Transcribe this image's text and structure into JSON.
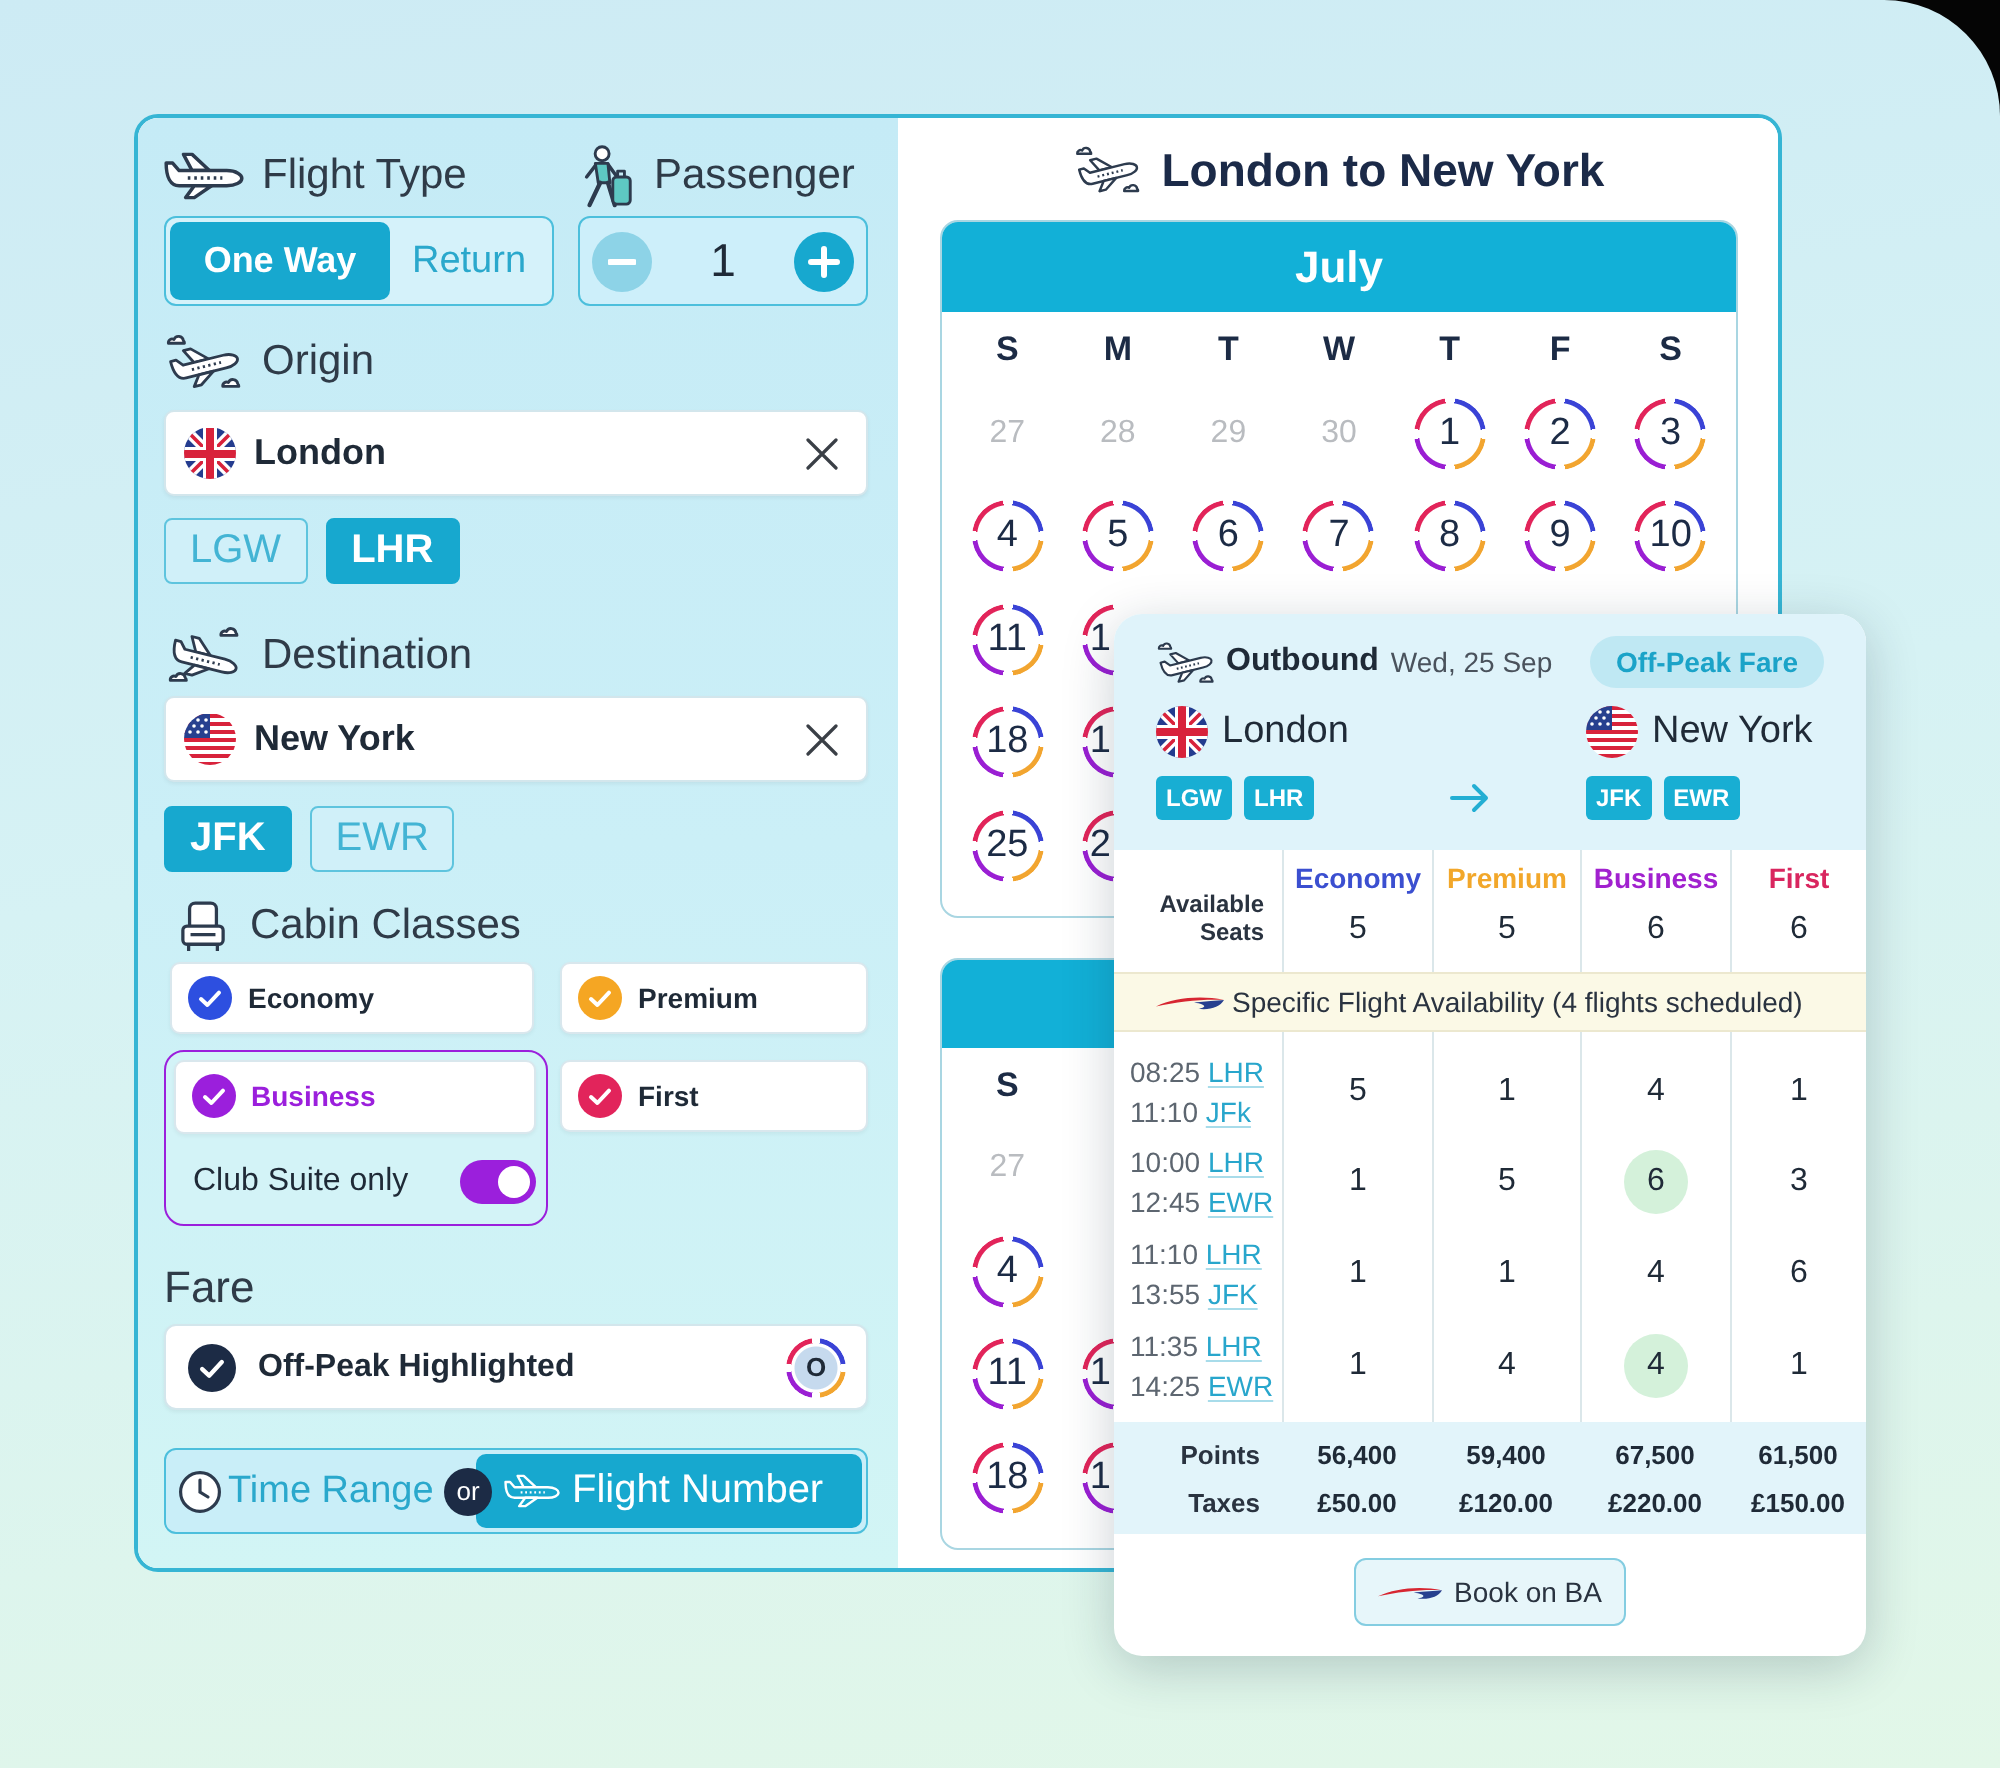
{
  "form": {
    "flight_type": {
      "label": "Flight Type",
      "options": [
        {
          "label": "One Way",
          "selected": true
        },
        {
          "label": "Return",
          "selected": false
        }
      ]
    },
    "passenger": {
      "label": "Passenger",
      "count": "1",
      "decrease_disabled": true
    },
    "origin": {
      "label": "Origin",
      "value": "London",
      "airports": [
        {
          "code": "LGW",
          "selected": false
        },
        {
          "code": "LHR",
          "selected": true
        }
      ]
    },
    "destination": {
      "label": "Destination",
      "value": "New York",
      "airports": [
        {
          "code": "JFK",
          "selected": true
        },
        {
          "code": "EWR",
          "selected": false
        }
      ]
    },
    "cabin_classes": {
      "label": "Cabin Classes",
      "items": [
        {
          "name": "Economy",
          "checked": true,
          "color": "#2d4fe0",
          "selected": false
        },
        {
          "name": "Premium",
          "checked": true,
          "color": "#f5a623",
          "selected": false
        },
        {
          "name": "Business",
          "checked": true,
          "color": "#9b1fdc",
          "selected": true,
          "option": {
            "label": "Club Suite only",
            "on": true
          }
        },
        {
          "name": "First",
          "checked": true,
          "color": "#e2245b",
          "selected": false
        }
      ]
    },
    "fare": {
      "label": "Fare",
      "option": {
        "label": "Off-Peak Highlighted",
        "checked": true,
        "badge": "O"
      }
    },
    "search_by": {
      "options": [
        {
          "kind": "time",
          "label": "Time Range",
          "selected": false
        },
        {
          "kind": "flight",
          "label": "Flight Number",
          "selected": true
        }
      ],
      "separator": "or"
    }
  },
  "calendar": {
    "title": "London to New York",
    "months": [
      {
        "month": "July",
        "weekdays": [
          "S",
          "M",
          "T",
          "W",
          "T",
          "F",
          "S"
        ],
        "weeks": [
          {
            "cut_off": false,
            "days": [
              {
                "label": "27",
                "available": false
              },
              {
                "label": "28",
                "available": false
              },
              {
                "label": "29",
                "available": false
              },
              {
                "label": "30",
                "available": false
              },
              {
                "label": "1",
                "available": true
              },
              {
                "label": "2",
                "available": true
              },
              {
                "label": "3",
                "available": true
              }
            ]
          },
          {
            "cut_off": false,
            "days": [
              {
                "label": "4",
                "available": true
              },
              {
                "label": "5",
                "available": true
              },
              {
                "label": "6",
                "available": true
              },
              {
                "label": "7",
                "available": true
              },
              {
                "label": "8",
                "available": true
              },
              {
                "label": "9",
                "available": true
              },
              {
                "label": "10",
                "available": true
              }
            ]
          },
          {
            "cut_off": true,
            "days": [
              {
                "label": "11",
                "available": true
              },
              {
                "label": "1",
                "available": true
              }
            ]
          },
          {
            "cut_off": true,
            "days": [
              {
                "label": "18",
                "available": true
              },
              {
                "label": "1",
                "available": true
              }
            ]
          },
          {
            "cut_off": true,
            "days": [
              {
                "label": "25",
                "available": true
              },
              {
                "label": "2",
                "available": true
              }
            ]
          }
        ]
      },
      {
        "weekdays": [
          "S"
        ],
        "weeks": [
          {
            "cut_off": false,
            "days": [
              {
                "label": "27",
                "available": false
              }
            ]
          },
          {
            "cut_off": false,
            "days": [
              {
                "label": "4",
                "available": true
              }
            ]
          },
          {
            "cut_off": true,
            "days": [
              {
                "label": "11",
                "available": true
              },
              {
                "label": "1",
                "available": true
              }
            ]
          },
          {
            "cut_off": true,
            "days": [
              {
                "label": "18",
                "available": true
              },
              {
                "label": "1",
                "available": true
              }
            ]
          }
        ]
      }
    ]
  },
  "flight_detail": {
    "direction": "Outbound",
    "date": "Wed, 25 Sep",
    "badge": "Off-Peak Fare",
    "origin": {
      "city": "London",
      "airports": [
        "LGW",
        "LHR"
      ]
    },
    "destination": {
      "city": "New York",
      "airports": [
        "JFK",
        "EWR"
      ]
    },
    "seats_label": "Available Seats",
    "classes": [
      {
        "name": "Economy",
        "color": "#3b4fd0",
        "seats": "5"
      },
      {
        "name": "Premium",
        "color": "#f2a72a",
        "seats": "5"
      },
      {
        "name": "Business",
        "color": "#a121cf",
        "seats": "6"
      },
      {
        "name": "First",
        "color": "#d9265f",
        "seats": "6"
      }
    ],
    "availability_note": "Specific Flight Availability (4 flights scheduled)",
    "flights": [
      {
        "departure_time": "08:25",
        "departure_airport": "LHR",
        "arrival_time": "11:10",
        "arrival_airport": "JFk",
        "seats": [
          {
            "value": "5",
            "highlighted": false
          },
          {
            "value": "1",
            "highlighted": false
          },
          {
            "value": "4",
            "highlighted": false
          },
          {
            "value": "1",
            "highlighted": false
          }
        ]
      },
      {
        "departure_time": "10:00",
        "departure_airport": "LHR",
        "arrival_time": "12:45",
        "arrival_airport": "EWR",
        "seats": [
          {
            "value": "1",
            "highlighted": false
          },
          {
            "value": "5",
            "highlighted": false
          },
          {
            "value": "6",
            "highlighted": true
          },
          {
            "value": "3",
            "highlighted": false
          }
        ]
      },
      {
        "departure_time": "11:10",
        "departure_airport": "LHR",
        "arrival_time": "13:55",
        "arrival_airport": "JFK",
        "seats": [
          {
            "value": "1",
            "highlighted": false
          },
          {
            "value": "1",
            "highlighted": false
          },
          {
            "value": "4",
            "highlighted": false
          },
          {
            "value": "6",
            "highlighted": false
          }
        ]
      },
      {
        "departure_time": "11:35",
        "departure_airport": "LHR",
        "arrival_time": "14:25",
        "arrival_airport": "EWR",
        "seats": [
          {
            "value": "1",
            "highlighted": false
          },
          {
            "value": "4",
            "highlighted": false
          },
          {
            "value": "4",
            "highlighted": true
          },
          {
            "value": "1",
            "highlighted": false
          }
        ]
      }
    ],
    "totals": [
      {
        "label": "Points",
        "values": [
          "56,400",
          "59,400",
          "67,500",
          "61,500"
        ]
      },
      {
        "label": "Taxes",
        "values": [
          "£50.00",
          "£120.00",
          "£220.00",
          "£150.00"
        ]
      }
    ],
    "book_button": "Book on BA"
  }
}
